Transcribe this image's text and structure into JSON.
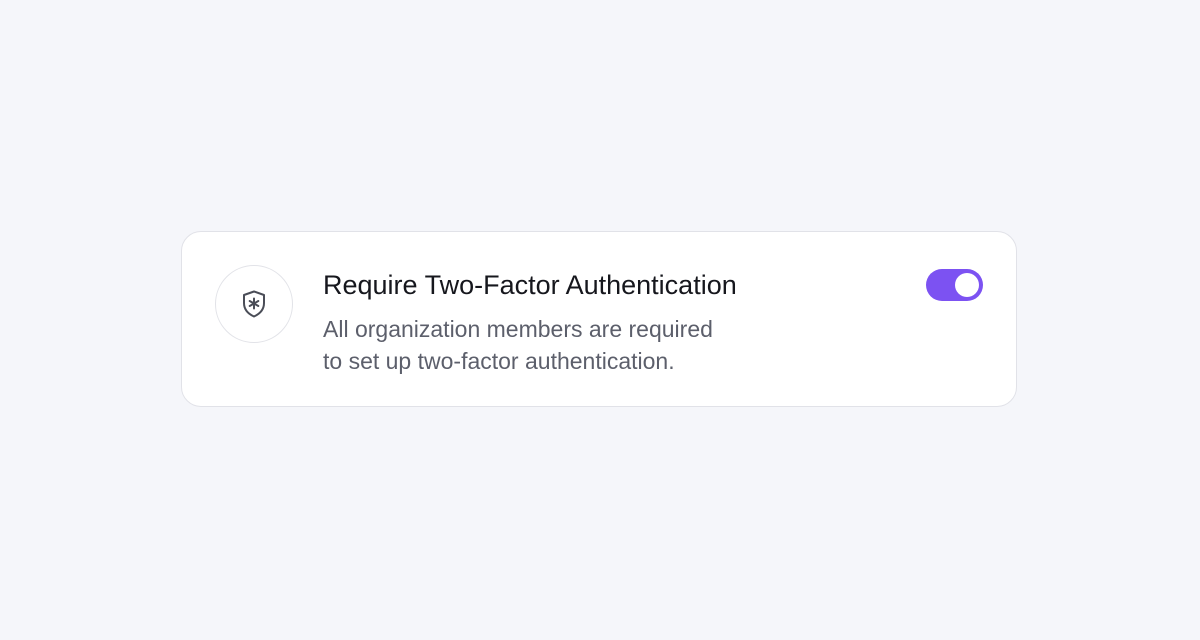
{
  "setting": {
    "title": "Require Two-Factor Authentication",
    "description_lines": [
      "All organization members are required",
      "to set up two-factor authentication."
    ],
    "icon": "shield-asterisk-icon",
    "toggle": {
      "state": "on"
    }
  },
  "colors": {
    "background": "#f5f6fa",
    "card": "#ffffff",
    "card_border": "#e1e2e8",
    "accent": "#7c52f2",
    "title_text": "#16171d",
    "description_text": "#5c5f6b",
    "icon_stroke": "#4a4d57"
  }
}
